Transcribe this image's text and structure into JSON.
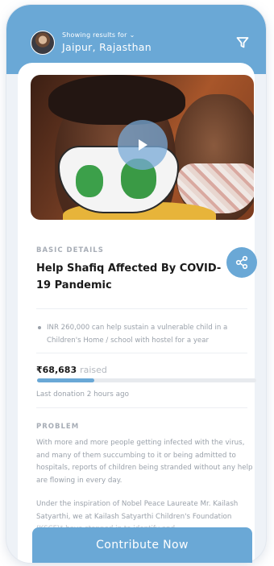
{
  "header": {
    "caption": "Showing results for",
    "location": "Jaipur, Rajasthan"
  },
  "icons": {
    "avatar": "user-avatar",
    "chevron": "chevron-down-icon",
    "filter": "filter-icon",
    "play": "play-icon",
    "share": "share-icon"
  },
  "colors": {
    "accent": "#6aa8d6",
    "muted_text": "#9aa1aa",
    "title_text": "#1a1a1a"
  },
  "details": {
    "label": "BASIC DETAILS",
    "title": "Help Shafiq Affected By COVID-19 Pandemic",
    "impact": "INR 260,000 can help sustain a vulnerable child in a Children's Home / school with hostel for a year"
  },
  "funding": {
    "raised_amount": "₹68,683",
    "raised_word": "raised",
    "progress_fraction": 0.26,
    "last_donation": "Last donation 2 hours ago"
  },
  "problem": {
    "label": "PROBLEM",
    "paragraph1": "With more and more people getting infected with the virus, and many of them succumbing to it or being admitted to hospitals, reports of children being stranded without any help are flowing in every day.",
    "paragraph2": "Under the inspiration of Nobel Peace Laureate Mr. Kailash Satyarthi, we at Kailash Satyarthi Children's Foundation (KSCF)* have stepped in to identify and"
  },
  "cta": {
    "label": "Contribute Now"
  }
}
